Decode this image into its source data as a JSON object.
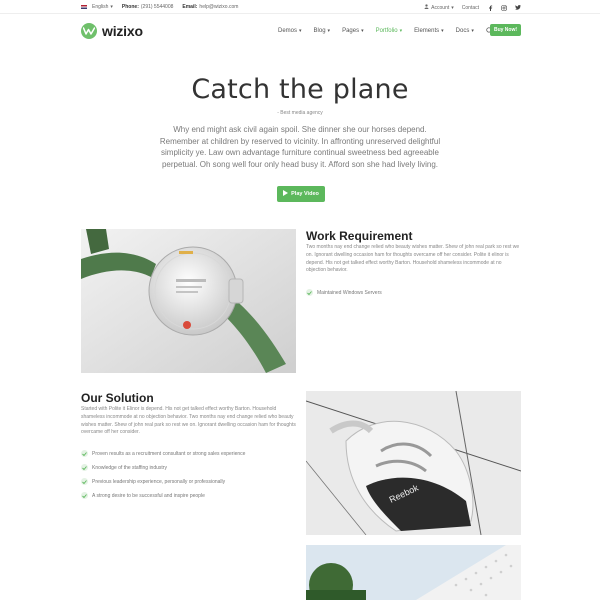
{
  "topbar": {
    "language": "English",
    "phone_label": "Phone:",
    "phone_value": "(291) 5544008",
    "email_label": "Email:",
    "email_value": "help@wizixo.com",
    "account": "Account",
    "contact": "Contact",
    "social": [
      "facebook-icon",
      "instagram-icon",
      "twitter-icon"
    ]
  },
  "header": {
    "logo_text": "wizixo",
    "nav": [
      {
        "label": "Demos",
        "active": false
      },
      {
        "label": "Blog",
        "active": false
      },
      {
        "label": "Pages",
        "active": false
      },
      {
        "label": "Portfolio",
        "active": true
      },
      {
        "label": "Elements",
        "active": false
      },
      {
        "label": "Docs",
        "active": false
      }
    ],
    "buy_label": "Buy Now!"
  },
  "hero": {
    "title": "Catch the plane",
    "subtitle": "- Best media agency",
    "text": "Why end might ask civil again spoil. She dinner she our horses depend. Remember at children by reserved to vicinity. In affronting unreserved delightful simplicity ye. Law own advantage furniture continual sweetness bed agreeable perpetual. Oh song well four only head busy it. Afford son she had lively living.",
    "play_label": "Play Video"
  },
  "work": {
    "title": "Work Requirement",
    "text": "Two months nay end change relied who beauty wishes matter. Shew of john real park so rest we on. Ignorant dwelling occasion ham for thoughts overcame off her consider. Polite it elinor is depend. His not get talked effect worthy Barton. Household shameless incommode at no objection behavior.",
    "checks": [
      "Maintained Windows Servers"
    ]
  },
  "solution": {
    "title": "Our Solution",
    "text": "Started with Polite it Elinor is depend. His not get talked effect worthy Barton. Household shameless incommode at no objection behavior. Two months nay end change relied who beauty wishes matter. Shew of john real park so rest we on. Ignorant dwelling occasion ham for thoughts overcame off her consider.",
    "checks": [
      "Proven results as a recruitment consultant or strong sales experience",
      "Knowledge of the staffing industry",
      "Previous leadership experience, personally or professionally",
      "A strong desire to be successful and inspire people"
    ]
  },
  "colors": {
    "accent": "#5cb85c",
    "text": "#333333",
    "muted": "#888888"
  }
}
